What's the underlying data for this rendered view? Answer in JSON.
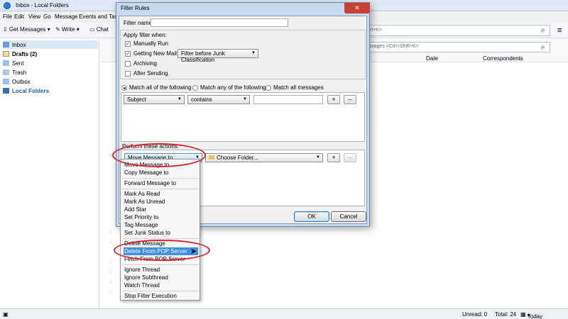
{
  "window": {
    "title": "Inbox - Local Folders",
    "menu": [
      "File",
      "Edit",
      "View",
      "Go",
      "Message",
      "Events and Tas"
    ]
  },
  "toolbar": {
    "get_messages": "Get Messages",
    "write": "Write",
    "chat": "Chat",
    "search_placeholder": "<Ctrl+K>",
    "quick_filter_placeholder": "messages <Ctrl+Shift+K>"
  },
  "folders": [
    {
      "label": "Inbox",
      "selected": true
    },
    {
      "label": "Drafts (2)",
      "bold": true
    },
    {
      "label": "Sent"
    },
    {
      "label": "Trash"
    },
    {
      "label": "Outbox"
    },
    {
      "label": "Local Folders",
      "accent": true
    }
  ],
  "thread_columns": [
    "Date",
    "Correspondents"
  ],
  "status": {
    "unread": "Unread: 0",
    "total": "Total: 24",
    "today_pane": "Today Pane"
  },
  "dialog": {
    "title": "Filter Rules",
    "close": "✕",
    "filter_name_label": "Filter name:",
    "apply_when_label": "Apply filter when:",
    "apply_options": [
      {
        "label": "Manually Run",
        "checked": true
      },
      {
        "label": "Getting New Mail:",
        "checked": true
      },
      {
        "label": "Archiving",
        "checked": false
      },
      {
        "label": "After Sending",
        "checked": false
      }
    ],
    "new_mail_option": "Filter before Junk Classification",
    "match_all": "Match all of the following",
    "match_any": "Match any of the following",
    "match_all_messages": "Match all messages",
    "criteria_field": "Subject",
    "criteria_operator": "contains",
    "plus": "+",
    "minus": "–",
    "actions_label": "Perform these actions:",
    "action_selected": "Move Message to",
    "choose_folder": "Choose Folder...",
    "ok": "OK",
    "cancel": "Cancel"
  },
  "action_menu": [
    "Move Message to",
    "Copy Message to",
    "Forward Message to",
    "Mark As Read",
    "Mark As Unread",
    "Add Star",
    "Set Priority to",
    "Tag Message",
    "Set Junk Status to",
    "Delete Message",
    "Delete From POP Server",
    "Fetch From POP Server",
    "Ignore Thread",
    "Ignore Subthread",
    "Watch Thread",
    "Stop Filter Execution"
  ],
  "colors": {
    "highlight": "#3d8ee6",
    "annotation": "#d8242b",
    "close_button": "#c94133"
  }
}
